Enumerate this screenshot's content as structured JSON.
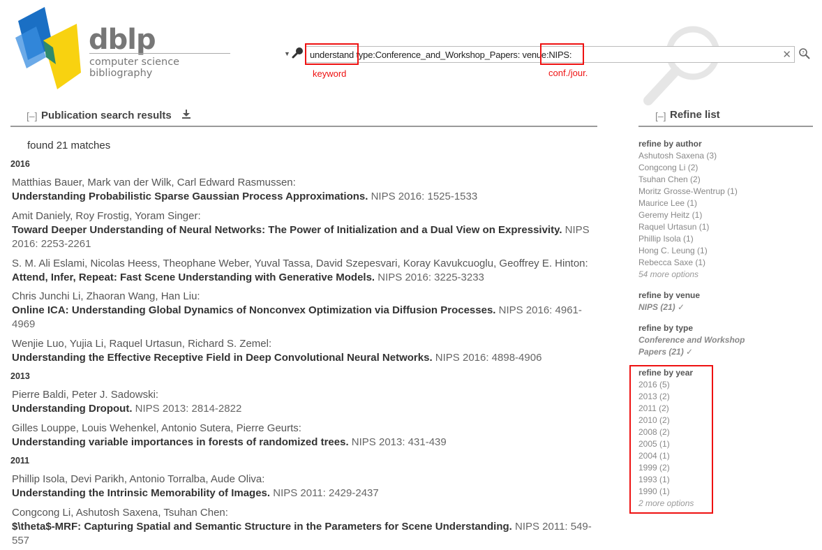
{
  "logo": {
    "title": "dblp",
    "subtitle": "computer science bibliography"
  },
  "search": {
    "dropdown": "▼",
    "query": "understand type:Conference_and_Workshop_Papers: venue:NIPS:",
    "annotation_keyword": "keyword",
    "annotation_venue": "conf./jour."
  },
  "results": {
    "collapse": "[–]",
    "title": "Publication search results",
    "found": "found 21 matches",
    "groups": [
      {
        "year": "2016",
        "entries": [
          {
            "authors": "Matthias Bauer, Mark van der Wilk, Carl Edward Rasmussen:",
            "title": "Understanding Probabilistic Sparse Gaussian Process Approximations.",
            "venue": "NIPS 2016: 1525-1533"
          },
          {
            "authors": "Amit Daniely, Roy Frostig, Yoram Singer:",
            "title": "Toward Deeper Understanding of Neural Networks: The Power of Initialization and a Dual View on Expressivity.",
            "venue": "NIPS 2016: 2253-2261"
          },
          {
            "authors": "S. M. Ali Eslami, Nicolas Heess, Theophane Weber, Yuval Tassa, David Szepesvari, Koray Kavukcuoglu, Geoffrey E. Hinton:",
            "title": "Attend, Infer, Repeat: Fast Scene Understanding with Generative Models.",
            "venue": "NIPS 2016: 3225-3233"
          },
          {
            "authors": "Chris Junchi Li, Zhaoran Wang, Han Liu:",
            "title": "Online ICA: Understanding Global Dynamics of Nonconvex Optimization via Diffusion Processes.",
            "venue": "NIPS 2016: 4961-4969"
          },
          {
            "authors": "Wenjie Luo, Yujia Li, Raquel Urtasun, Richard S. Zemel:",
            "title": "Understanding the Effective Receptive Field in Deep Convolutional Neural Networks.",
            "venue": "NIPS 2016: 4898-4906"
          }
        ]
      },
      {
        "year": "2013",
        "entries": [
          {
            "authors": "Pierre Baldi, Peter J. Sadowski:",
            "title": "Understanding Dropout.",
            "venue": "NIPS 2013: 2814-2822"
          },
          {
            "authors": "Gilles Louppe, Louis Wehenkel, Antonio Sutera, Pierre Geurts:",
            "title": "Understanding variable importances in forests of randomized trees.",
            "venue": "NIPS 2013: 431-439"
          }
        ]
      },
      {
        "year": "2011",
        "entries": [
          {
            "authors": "Phillip Isola, Devi Parikh, Antonio Torralba, Aude Oliva:",
            "title": "Understanding the Intrinsic Memorability of Images.",
            "venue": "NIPS 2011: 2429-2437"
          },
          {
            "authors": "Congcong Li, Ashutosh Saxena, Tsuhan Chen:",
            "title": "$\\theta$-MRF: Capturing Spatial and Semantic Structure in the Parameters for Scene Understanding.",
            "venue": "NIPS 2011: 549-557"
          }
        ]
      }
    ]
  },
  "refine": {
    "collapse": "[–]",
    "title": "Refine list",
    "author": {
      "heading": "refine by author",
      "items": [
        "Ashutosh Saxena (3)",
        "Congcong Li (2)",
        "Tsuhan Chen (2)",
        "Moritz Grosse-Wentrup (1)",
        "Maurice Lee (1)",
        "Geremy Heitz (1)",
        "Raquel Urtasun (1)",
        "Phillip Isola (1)",
        "Hong C. Leung (1)",
        "Rebecca Saxe (1)"
      ],
      "more": "54 more options"
    },
    "venue": {
      "heading": "refine by venue",
      "selected": "NIPS (21) ✓"
    },
    "type": {
      "heading": "refine by type",
      "selected_line1": "Conference and Workshop",
      "selected_line2": "Papers (21) ✓"
    },
    "year": {
      "heading": "refine by year",
      "items": [
        "2016 (5)",
        "2013 (2)",
        "2011 (2)",
        "2010 (2)",
        "2008 (2)",
        "2005 (1)",
        "2004 (1)",
        "1999 (2)",
        "1993 (1)",
        "1990 (1)"
      ],
      "more": "2 more options"
    }
  },
  "colors": {
    "highlight": "#e11111",
    "logo_blue": "#1a6fc4",
    "logo_yellow": "#f8d210"
  }
}
